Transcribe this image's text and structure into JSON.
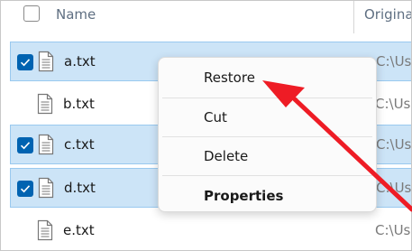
{
  "header": {
    "name_label": "Name",
    "original_label": "Origina"
  },
  "files": [
    {
      "name": "a.txt",
      "path": "C:\\User",
      "selected": true
    },
    {
      "name": "b.txt",
      "path": "C:\\User",
      "selected": false
    },
    {
      "name": "c.txt",
      "path": "C:\\User",
      "selected": true
    },
    {
      "name": "d.txt",
      "path": "C:\\User",
      "selected": true
    },
    {
      "name": "e.txt",
      "path": "C:\\User",
      "selected": false
    }
  ],
  "context_menu": {
    "items": [
      "Restore",
      "Cut",
      "Delete",
      "Properties"
    ]
  },
  "colors": {
    "selection_bg": "#cce4f7",
    "checkbox_blue": "#0063b1",
    "arrow_red": "#ee1c25"
  }
}
